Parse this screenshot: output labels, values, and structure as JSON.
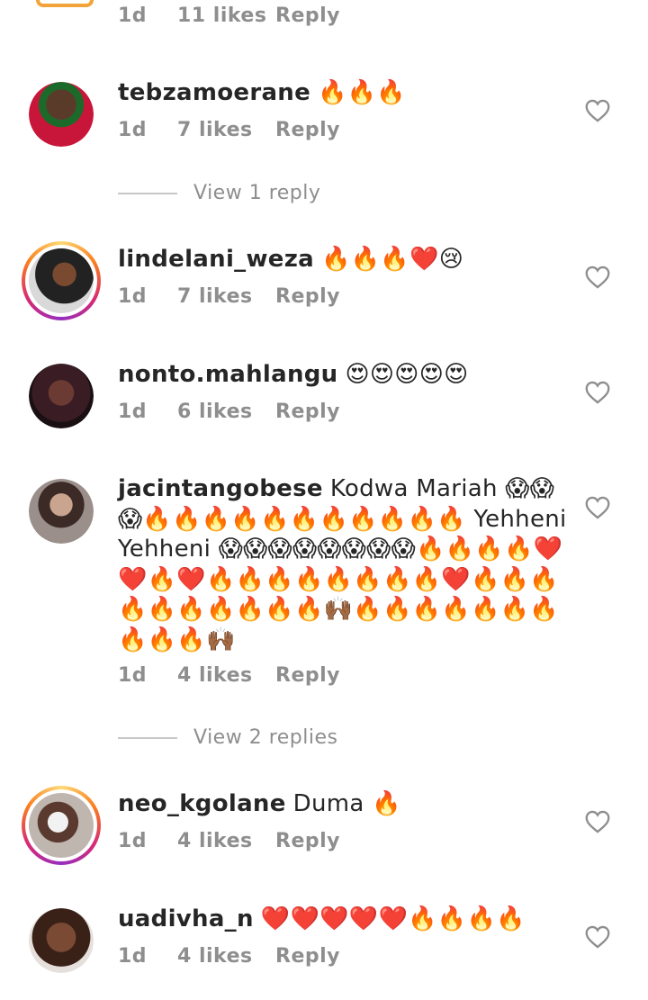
{
  "top_partial": {
    "time": "1d",
    "likes": "11 likes",
    "reply": "Reply"
  },
  "comments": [
    {
      "username": "tebzamoerane",
      "text": "🔥🔥🔥",
      "time": "1d",
      "likes": "7 likes",
      "reply": "Reply",
      "avatar_color": "#b81d3a"
    },
    {
      "username": "lindelani_weza",
      "text": "🔥🔥🔥❤️😢",
      "time": "1d",
      "likes": "7 likes",
      "reply": "Reply",
      "avatar_color": "#3a3a3a"
    },
    {
      "username": "nonto.mahlangu",
      "text": "😍😍😍😍😍",
      "time": "1d",
      "likes": "6 likes",
      "reply": "Reply",
      "avatar_color": "#2e1a22"
    },
    {
      "username": "jacintangobese",
      "text": "Kodwa Mariah 😱😱😱🔥🔥🔥🔥🔥🔥🔥🔥🔥🔥🔥 Yehheni Yehheni 😱😱😱😱😱😱😱😱🔥🔥🔥🔥❤️❤️🔥❤️🔥🔥🔥🔥🔥🔥🔥🔥❤️🔥🔥🔥🔥🔥🔥🔥🔥🔥🔥🙌🏾🔥🔥🔥🔥🔥🔥🔥🔥🔥🔥🙌🏾",
      "time": "1d",
      "likes": "4 likes",
      "reply": "Reply",
      "avatar_color": "#6b5a55"
    },
    {
      "username": "neo_kgolane",
      "text": "Duma 🔥",
      "time": "1d",
      "likes": "4 likes",
      "reply": "Reply",
      "avatar_color": "#c9c0bb"
    },
    {
      "username": "uadivha_n",
      "text": "❤️❤️❤️❤️❤️🔥🔥🔥🔥",
      "time": "1d",
      "likes": "4 likes",
      "reply": "Reply",
      "avatar_color": "#4a2f25"
    }
  ],
  "replies_links": {
    "first": "View 1 reply",
    "second": "View 2 replies"
  },
  "colors": {
    "meta_gray": "#8e8e8e",
    "text": "#262626",
    "divider": "#c7c7c7"
  },
  "icons": {
    "like": "heart-outline-icon"
  }
}
